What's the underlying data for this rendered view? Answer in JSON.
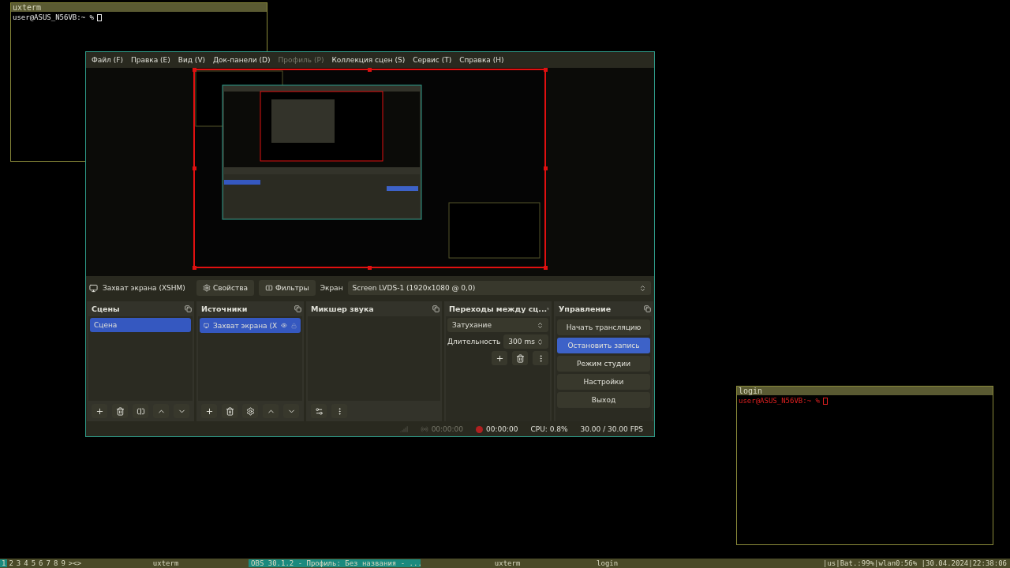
{
  "xterm": {
    "title": "uxterm",
    "prompt": "user@ASUS_N56VB:~ %"
  },
  "obs": {
    "menu": [
      {
        "label": "Файл (F)",
        "disabled": false
      },
      {
        "label": "Правка (E)",
        "disabled": false
      },
      {
        "label": "Вид (V)",
        "disabled": false
      },
      {
        "label": "Док-панели (D)",
        "disabled": false
      },
      {
        "label": "Профиль (P)",
        "disabled": true
      },
      {
        "label": "Коллекция сцен (S)",
        "disabled": false
      },
      {
        "label": "Сервис (T)",
        "disabled": false
      },
      {
        "label": "Справка (H)",
        "disabled": false
      }
    ],
    "source_toolbar": {
      "source": "Захват экрана (XSHM)",
      "properties": "Свойства",
      "filters": "Фильтры",
      "screen_label": "Экран",
      "screen_value": "Screen LVDS-1 (1920x1080 @ 0,0)"
    },
    "scenes": {
      "title": "Сцены",
      "items": [
        {
          "label": "Сцена",
          "selected": true
        }
      ]
    },
    "sources": {
      "title": "Источники",
      "items": [
        {
          "label": "Захват экрана (X",
          "selected": true,
          "visible": true,
          "locked": false
        }
      ]
    },
    "mixer": {
      "title": "Микшер звука"
    },
    "transitions": {
      "title": "Переходы между сц...",
      "transition": "Затухание",
      "duration_label": "Длительность",
      "duration": "300 ms"
    },
    "controls": {
      "title": "Управление",
      "buttons": [
        {
          "label": "Начать трансляцию",
          "active": false
        },
        {
          "label": "Остановить запись",
          "active": true
        },
        {
          "label": "Режим студии",
          "active": false
        },
        {
          "label": "Настройки",
          "active": false
        },
        {
          "label": "Выход",
          "active": false
        }
      ]
    },
    "status_bar": {
      "stream_time": "00:00:00",
      "record_time": "00:00:00",
      "recording": true,
      "cpu": "CPU: 0.8%",
      "fps": "30.00 / 30.00 FPS"
    }
  },
  "login": {
    "title": "login",
    "prompt": "user@ASUS_N56VB:~ %"
  },
  "taskbar": {
    "workspaces": [
      {
        "label": "1",
        "selected": true
      },
      {
        "label": "2",
        "selected": false
      },
      {
        "label": "3",
        "selected": false
      },
      {
        "label": "4",
        "selected": false
      },
      {
        "label": "5",
        "selected": false
      },
      {
        "label": "6",
        "selected": false
      },
      {
        "label": "7",
        "selected": false
      },
      {
        "label": "8",
        "selected": false
      },
      {
        "label": "9",
        "selected": false
      }
    ],
    "layout": "><>",
    "windows": [
      {
        "label": "uxterm",
        "selected": false
      },
      {
        "label": "OBS 30.1.2 - Профиль: Без названия - ...",
        "selected": true
      },
      {
        "label": "uxterm",
        "selected": false
      },
      {
        "label": "login",
        "selected": false
      }
    ],
    "status": "|us|Bat.:99%|wlan0:56% |30.04.2024|22:38:06"
  }
}
